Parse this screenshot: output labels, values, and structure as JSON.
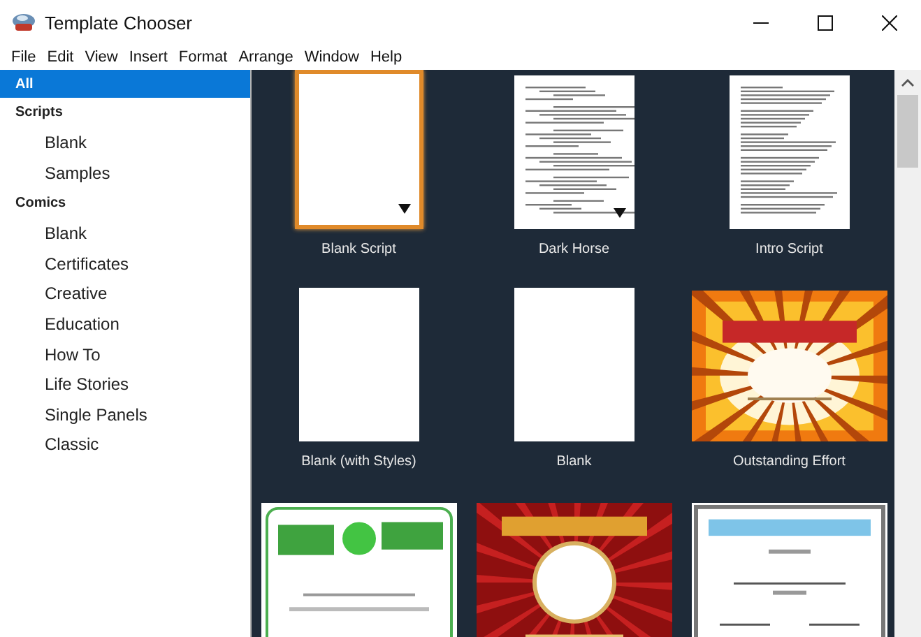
{
  "window": {
    "title": "Template Chooser"
  },
  "menu": [
    "File",
    "Edit",
    "View",
    "Insert",
    "Format",
    "Arrange",
    "Window",
    "Help"
  ],
  "sidebar": {
    "items": [
      {
        "kind": "all",
        "label": "All",
        "selected": true
      },
      {
        "kind": "header",
        "label": "Scripts",
        "selected": false
      },
      {
        "kind": "item",
        "label": "Blank",
        "selected": false
      },
      {
        "kind": "item",
        "label": "Samples",
        "selected": false
      },
      {
        "kind": "header",
        "label": "Comics",
        "selected": false
      },
      {
        "kind": "item",
        "label": "Blank",
        "selected": false
      },
      {
        "kind": "item",
        "label": "Certificates",
        "selected": false
      },
      {
        "kind": "item",
        "label": "Creative",
        "selected": false
      },
      {
        "kind": "item",
        "label": "Education",
        "selected": false
      },
      {
        "kind": "item",
        "label": "How To",
        "selected": false
      },
      {
        "kind": "item",
        "label": "Life Stories",
        "selected": false
      },
      {
        "kind": "item",
        "label": "Single Panels",
        "selected": false
      },
      {
        "kind": "item",
        "label": "Classic",
        "selected": false
      }
    ]
  },
  "templates": [
    {
      "kind": "blank",
      "label": "Blank Script",
      "selected": true,
      "dropdown": true
    },
    {
      "kind": "script",
      "label": "Dark Horse",
      "selected": false,
      "dropdown": true
    },
    {
      "kind": "script",
      "label": "Intro Script",
      "selected": false,
      "dropdown": false
    },
    {
      "kind": "blank",
      "label": "Blank (with Styles)",
      "selected": false,
      "dropdown": false
    },
    {
      "kind": "blank",
      "label": "Blank",
      "selected": false,
      "dropdown": false
    },
    {
      "kind": "picture",
      "label": "Outstanding Effort",
      "selected": false,
      "dropdown": false
    },
    {
      "kind": "picture",
      "selected": false,
      "dropdown": false
    },
    {
      "kind": "picture",
      "selected": false,
      "dropdown": false
    },
    {
      "kind": "picture",
      "selected": false,
      "dropdown": false
    }
  ]
}
